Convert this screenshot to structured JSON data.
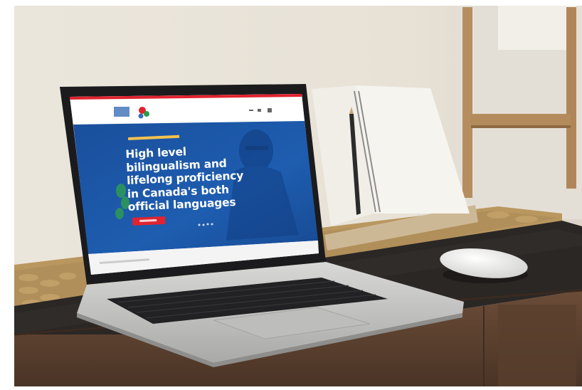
{
  "photo": {
    "subject": "laptop-on-desk",
    "screen": {
      "site_headline_lines": [
        "High level",
        "bilingualism and",
        "lifelong proficiency",
        "in Canada's both",
        "official languages"
      ]
    }
  },
  "colors": {
    "wall": "#e9e3d8",
    "desk_top": "#2a2725",
    "desk_front": "#5e4331",
    "screen_blue": "#1f58a8",
    "accent_red": "#e0232f",
    "laptop_silver": "#c9c9c7",
    "notebook_paper": "#f4f1ea",
    "shelf_wood": "#b58d5f"
  }
}
